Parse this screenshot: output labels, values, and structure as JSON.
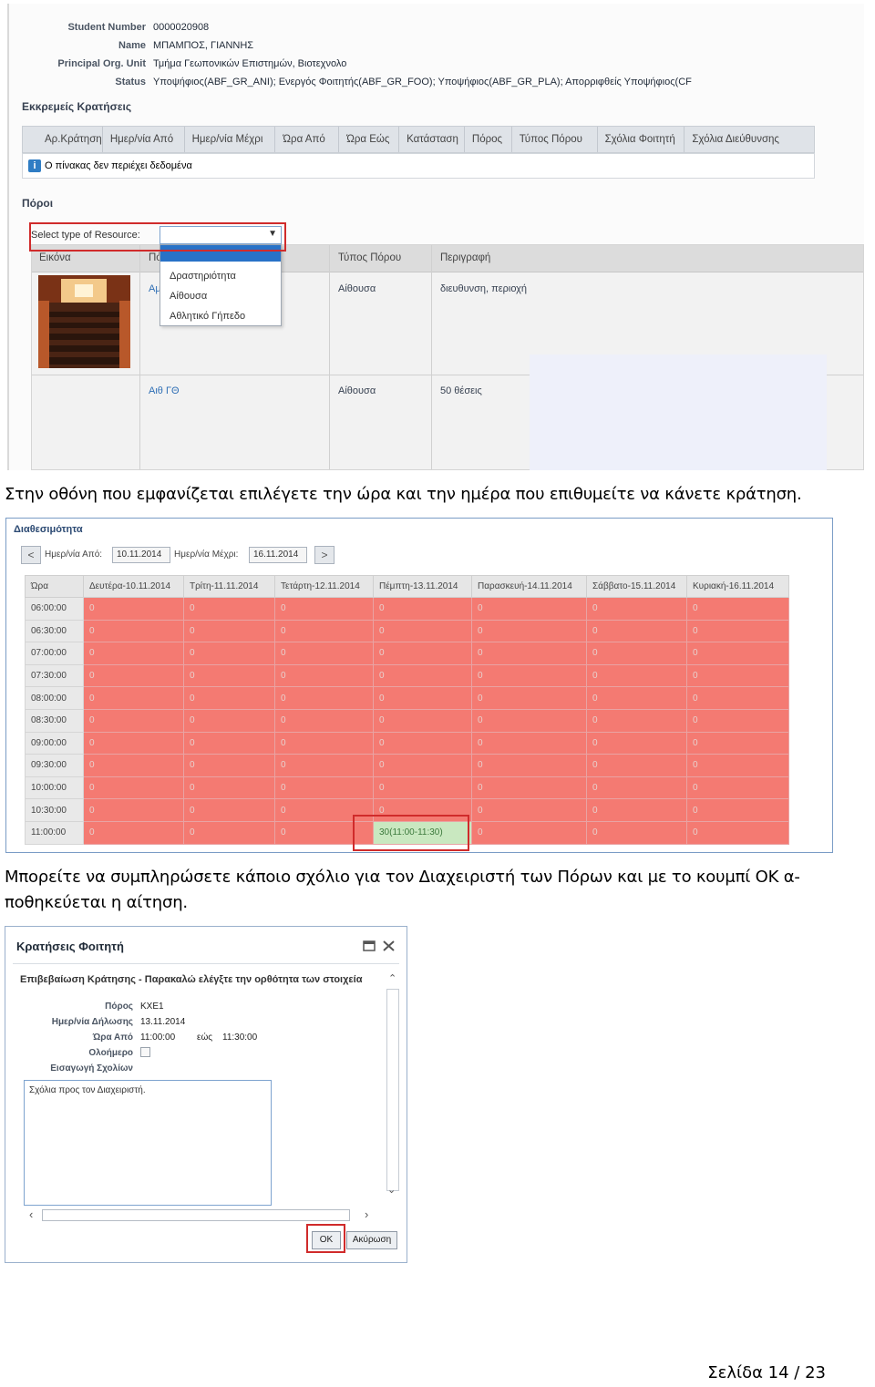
{
  "shot1": {
    "student_info": [
      {
        "label": "Student Number",
        "value": "0000020908"
      },
      {
        "label": "Name",
        "value": "ΜΠΑΜΠΟΣ, ΓΙΑΝΝΗΣ"
      },
      {
        "label": "Principal Org. Unit",
        "value": "Τμήμα Γεωπονικών Επιστημών, Βιοτεχνολο"
      },
      {
        "label": "Status",
        "value": "Υποψήφιος(ABF_GR_ANI); Ενεργός Φοιτητής(ABF_GR_FOO); Υποψήφιος(ABF_GR_PLA); Απορριφθείς Υποψήφιος(CF"
      }
    ],
    "pending_title": "Εκκρεμείς Κρατήσεις",
    "pending_columns": [
      "Αρ.Κράτησης",
      "Ημερ/νία Από",
      "Ημερ/νία Μέχρι",
      "Ώρα Από",
      "Ώρα Εώς",
      "Κατάσταση",
      "Πόρος",
      "Τύπος Πόρου",
      "Σχόλια Φοιτητή",
      "Σχόλια Διεύθυνσης"
    ],
    "empty_message": "Ο πίνακας δεν περιέχει δεδομένα",
    "resources_title": "Πόροι",
    "select_label": "Select type of Resource:",
    "dropdown_options": [
      "Δραστηριότητα",
      "Αίθουσα",
      "Αθλητικό Γήπεδο"
    ],
    "resource_columns": [
      "Εικόνα",
      "Πό",
      "Τύπος Πόρου",
      "Περιγραφή"
    ],
    "resource_rows": [
      {
        "name": "Αμ",
        "type": "Αίθουσα",
        "description": "διευθυνση, περιοχή"
      },
      {
        "name": "Αιθ ΓΘ",
        "type": "Αίθουσα",
        "description": "50 θέσεις"
      }
    ]
  },
  "para1": "Στην οθόνη που εμφανίζεται επιλέγετε την ώρα και την ημέρα που επιθυμείτε να κάνετε κράτηση.",
  "shot2": {
    "title": "Διαθεσιμότητα",
    "date_from_label": "Ημερ/νία Από:",
    "date_from": "10.11.2014",
    "date_to_label": "Ημερ/νία Μέχρι:",
    "date_to": "16.11.2014",
    "prev_label": "<",
    "next_label": ">",
    "columns": [
      "Ώρα",
      "Δευτέρα-10.11.2014",
      "Τρίτη-11.11.2014",
      "Τετάρτη-12.11.2014",
      "Πέμπτη-13.11.2014",
      "Παρασκευή-14.11.2014",
      "Σάββατο-15.11.2014",
      "Κυριακή-16.11.2014"
    ],
    "times": [
      "06:00:00",
      "06:30:00",
      "07:00:00",
      "07:30:00",
      "08:00:00",
      "08:30:00",
      "09:00:00",
      "09:30:00",
      "10:00:00",
      "10:30:00",
      "11:00:00"
    ],
    "cell_value": "0",
    "free_slot": {
      "row": 10,
      "col": 4,
      "text": "30(11:00-11:30)"
    }
  },
  "para2_line1": "Μπορείτε να συμπληρώσετε κάποιο σχόλιο για τον Διαχειριστή των Πόρων και με το κουμπί ΟΚ α-",
  "para2_line2": "ποθηκεύεται η αίτηση.",
  "shot3": {
    "title": "Κρατήσεις Φοιτητή",
    "subtitle": "Επιβεβαίωση Κράτησης - Παρακαλώ ελέγξτε την ορθότητα των στοιχεία",
    "fields": [
      {
        "label": "Πόρος",
        "value": "ΚΧΕ1"
      },
      {
        "label": "Ημερ/νία Δήλωσης",
        "value": "13.11.2014"
      },
      {
        "label": "Ώρα Από",
        "value": "11:00:00"
      },
      {
        "label": "Ολοήμερο",
        "value": ""
      },
      {
        "label": "Εισαγωγή Σχολίων",
        "value": ""
      }
    ],
    "time_to_label": "εώς",
    "time_to": "11:30:00",
    "comment": "Σχόλια προς τον Διαχειριστή.",
    "ok_label": "OK",
    "cancel_label": "Ακύρωση"
  },
  "footer": "Σελίδα 14 / 23",
  "colors": {
    "busy": "#f47a72",
    "free": "#c9e8c0",
    "highlight": "#d02b2b"
  }
}
